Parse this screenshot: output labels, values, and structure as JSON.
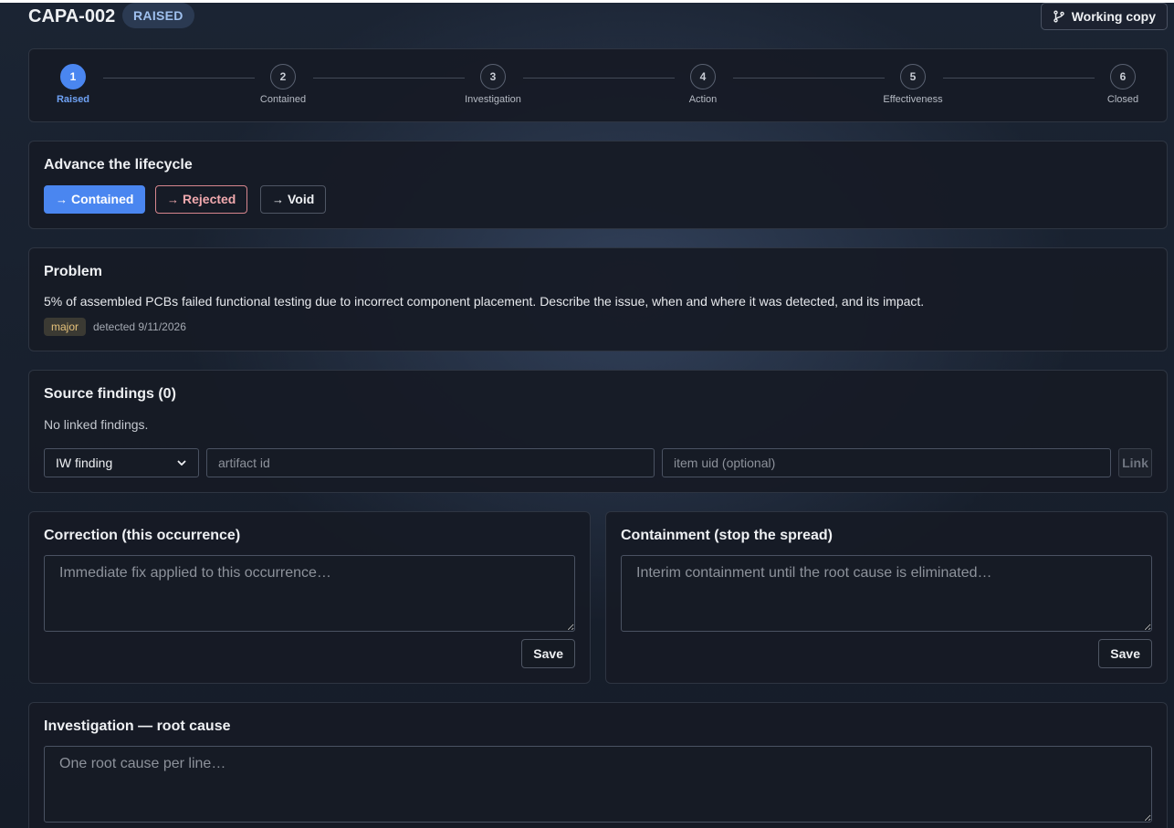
{
  "header": {
    "capa_id": "CAPA-002",
    "status": "RAISED",
    "working_copy_label": "Working copy"
  },
  "stepper": {
    "current_step": 1,
    "steps": [
      {
        "number": "1",
        "label": "Raised"
      },
      {
        "number": "2",
        "label": "Contained"
      },
      {
        "number": "3",
        "label": "Investigation"
      },
      {
        "number": "4",
        "label": "Action"
      },
      {
        "number": "5",
        "label": "Effectiveness"
      },
      {
        "number": "6",
        "label": "Closed"
      }
    ]
  },
  "lifecycle": {
    "title": "Advance the lifecycle",
    "arrow": "→",
    "contained_label": "Contained",
    "rejected_label": "Rejected",
    "void_label": "Void"
  },
  "problem": {
    "title": "Problem",
    "description": "5% of assembled PCBs failed functional testing due to incorrect component placement. Describe the issue, when and where it was detected, and its impact.",
    "severity": "major",
    "detected": "detected 9/11/2026"
  },
  "findings": {
    "title": "Source findings (0)",
    "empty_text": "No linked findings.",
    "type_selected": "IW finding",
    "artifact_placeholder": "artifact id",
    "uid_placeholder": "item uid (optional)",
    "link_label": "Link"
  },
  "correction": {
    "title": "Correction (this occurrence)",
    "placeholder": "Immediate fix applied to this occurrence…",
    "save_label": "Save"
  },
  "containment": {
    "title": "Containment (stop the spread)",
    "placeholder": "Interim containment until the root cause is eliminated…",
    "save_label": "Save"
  },
  "investigation": {
    "title": "Investigation — root cause",
    "placeholder": "One root cause per line…"
  },
  "colors": {
    "accent": "#4a86f0",
    "danger": "#f1a9ae",
    "severity_major": "#e6c27a"
  },
  "icons": {
    "working_copy": "git-branch-icon",
    "select": "chevron-down-icon"
  }
}
